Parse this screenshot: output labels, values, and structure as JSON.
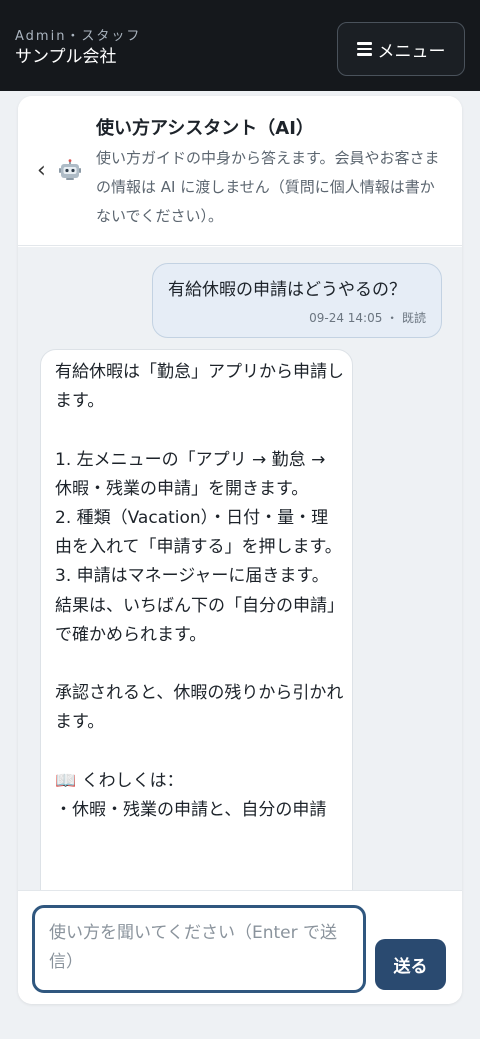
{
  "header": {
    "subtitle": "Admin・スタッフ",
    "company": "サンプル会社",
    "menu_label": "メニュー",
    "menu_icon": "hamburger-icon"
  },
  "assistant": {
    "back_icon": "chevron-left-icon",
    "bot_icon": "robot-icon",
    "title": "使い方アシスタント（AI）",
    "description": "使い方ガイドの中身から答えます。会員やお客さまの情報は AI に渡しません（質問に個人情報は書かないでください）。"
  },
  "messages": {
    "user": {
      "text": "有給休暇の申請はどうやるの？",
      "meta": "09-24 14:05 ・ 既読"
    },
    "bot": {
      "text": "有給休暇は「勤怠」アプリから申請します。\n\n1. 左メニューの「アプリ → 勤怠 → 休暇・残業の申請」を開きます。\n2. 種類（Vacation）・日付・量・理由を入れて「申請する」を押します。\n3. 申請はマネージャーに届きます。結果は、いちばん下の「自分の申請」で確かめられます。\n\n承認されると、休暇の残りから引かれます。\n\n📖 くわしくは：\n・休暇・残業の申請と、自分の申請"
    }
  },
  "composer": {
    "placeholder": "使い方を聞いてください（Enter で送信）",
    "send_label": "送る"
  },
  "colors": {
    "topbar": "#15181c",
    "accent": "#2a4a70",
    "user_bubble": "#e6edf6",
    "input_border": "#30577f"
  }
}
